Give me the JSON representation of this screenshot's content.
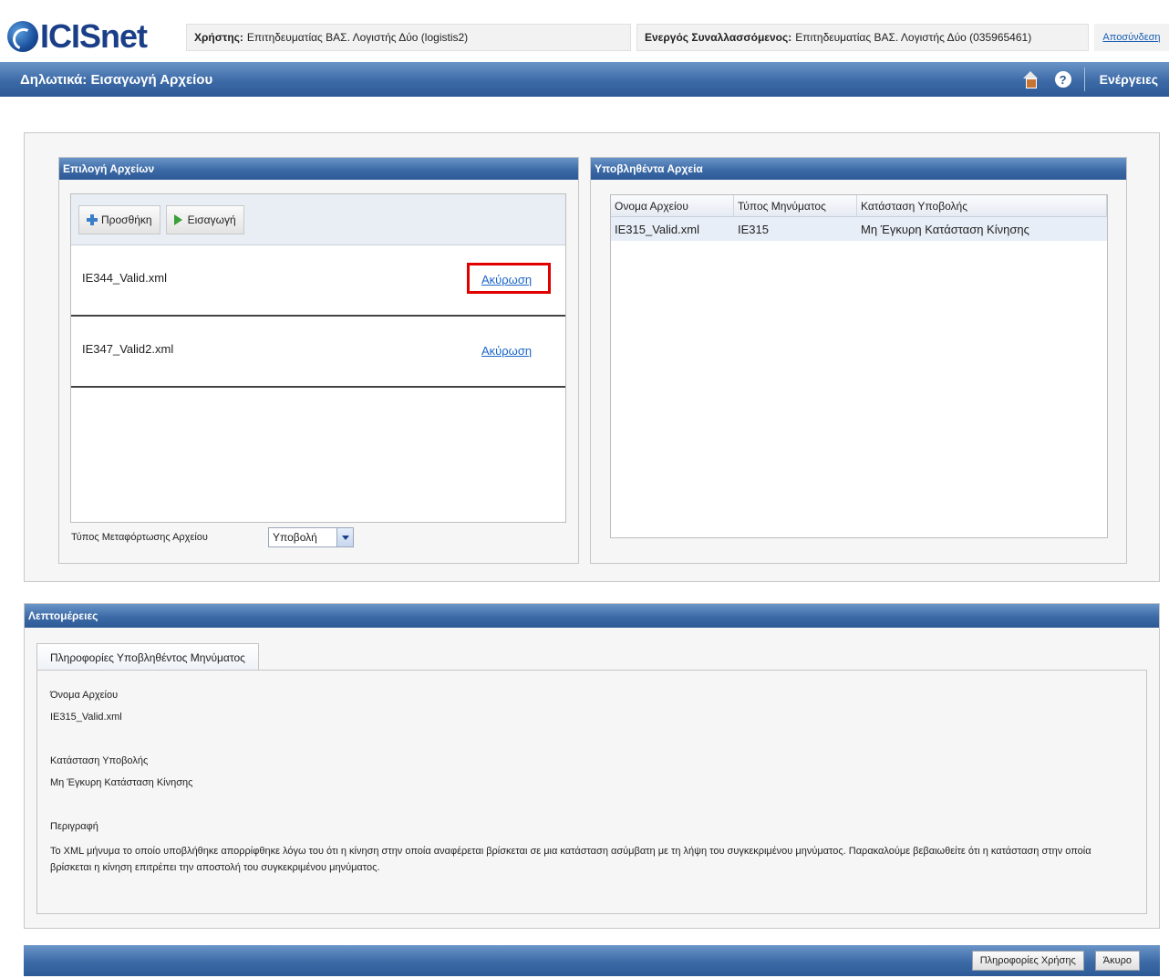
{
  "app": {
    "logo_text": "ICISnet"
  },
  "header": {
    "user_label": "Χρήστης:",
    "user_value": "Επιτηδευματίας ΒΑΣ. Λογιστής Δύο (logistis2)",
    "trader_label": "Ενεργός Συναλλασσόμενος:",
    "trader_value": "Επιτηδευματίας ΒΑΣ. Λογιστής Δύο (035965461)",
    "logout_label": "Αποσύνδεση"
  },
  "titlebar": {
    "title": "Δηλωτικά: Εισαγωγή Αρχείου",
    "actions_label": "Ενέργειες",
    "home_icon": "home-icon",
    "help_icon": "help-icon"
  },
  "file_selection": {
    "title": "Επιλογή Αρχείων",
    "add_label": "Προσθήκη",
    "import_label": "Εισαγωγή",
    "files": [
      {
        "name": "IE344_Valid.xml",
        "cancel_label": "Ακύρωση",
        "highlighted": true
      },
      {
        "name": "IE347_Valid2.xml",
        "cancel_label": "Ακύρωση",
        "highlighted": false
      }
    ],
    "upload_type_label": "Τύπος Μεταφόρτωσης Αρχείου",
    "upload_type_value": "Υποβολή"
  },
  "submitted_files": {
    "title": "Υποβληθέντα Αρχεία",
    "columns": [
      "Ονομα Αρχείου",
      "Τύπος Μηνύματος",
      "Κατάσταση Υποβολής"
    ],
    "rows": [
      {
        "file_name": "IE315_Valid.xml",
        "message_type": "IE315",
        "status": "Μη Έγκυρη Κατάσταση Κίνησης"
      }
    ]
  },
  "details": {
    "title": "Λεπτομέρειες",
    "tab_label": "Πληροφορίες Υποβληθέντος Μηνύματος",
    "file_name_label": "Όνομα Αρχείου",
    "file_name_value": "IE315_Valid.xml",
    "status_label": "Κατάσταση Υποβολής",
    "status_value": "Μη Έγκυρη Κατάσταση Κίνησης",
    "description_label": "Περιγραφή",
    "description_value": "Το XML μήνυμα το οποίο υποβλήθηκε απορρίφθηκε λόγω του ότι η κίνηση στην οποία αναφέρεται βρίσκεται σε μια κατάσταση ασύμβατη με τη λήψη του συγκεκριμένου μηνύματος. Παρακαλούμε βεβαιωθείτε ότι η κατάσταση στην οποία βρίσκεται η κίνηση επιτρέπει την αποστολή του συγκεκριμένου μηνύματος."
  },
  "footer": {
    "help_info_label": "Πληροφορίες Χρήσης",
    "cancel_label": "Άκυρο"
  },
  "colors": {
    "header_blue": "#3c6aa6",
    "link_blue": "#1a66c8",
    "highlight_red": "#e00000"
  }
}
